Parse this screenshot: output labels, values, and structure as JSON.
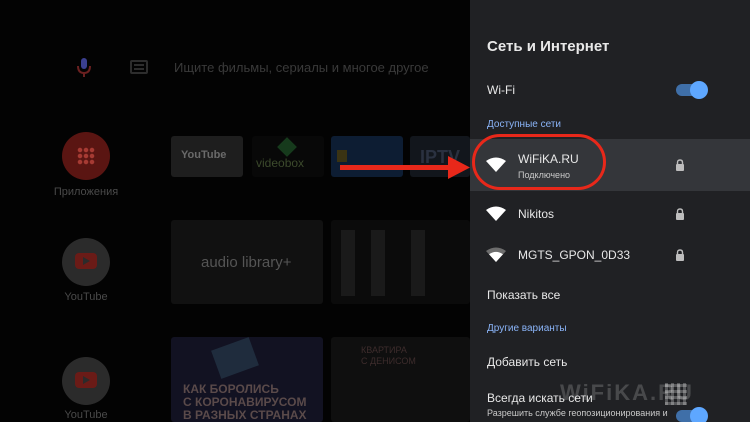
{
  "home": {
    "search_placeholder": "Ищите фильмы, сериалы и многое другое",
    "sidebar": [
      {
        "label": "Приложения",
        "icon": "apps-grid-icon"
      },
      {
        "label": "YouTube",
        "icon": "youtube-icon"
      },
      {
        "label": "YouTube",
        "icon": "youtube-icon"
      }
    ],
    "tiles": {
      "youtube": "YouTube",
      "videobox": "videobox",
      "iptv": "IPTV",
      "audio": "audio library+",
      "news_title": "КАК БОРОЛИСЬ\nС КОРОНАВИРУСОМ\nВ РАЗНЫХ СТРАНАХ",
      "news2_title": "КВАРТИРА\nС ДЕНИСОМ"
    }
  },
  "panel": {
    "title": "Сеть и Интернет",
    "wifi_label": "Wi-Fi",
    "wifi_enabled": true,
    "available_header": "Доступные сети",
    "networks": [
      {
        "name": "WiFiKA.RU",
        "status": "Подключено",
        "secured": true,
        "selected": true
      },
      {
        "name": "Nikitos",
        "status": "",
        "secured": true,
        "selected": false
      },
      {
        "name": "MGTS_GPON_0D33",
        "status": "",
        "secured": true,
        "selected": false
      }
    ],
    "show_all": "Показать все",
    "other_header": "Другие варианты",
    "add_network": "Добавить сеть",
    "always_scan": "Всегда искать сети",
    "always_scan_desc": "Разрешить службе геопозиционирования и",
    "always_scan_enabled": true
  },
  "watermark": "WiFiKA.RU",
  "colors": {
    "accent": "#5ea7ff",
    "section": "#8ab4f8",
    "highlight": "#e8281a",
    "panel_bg": "#202124"
  }
}
